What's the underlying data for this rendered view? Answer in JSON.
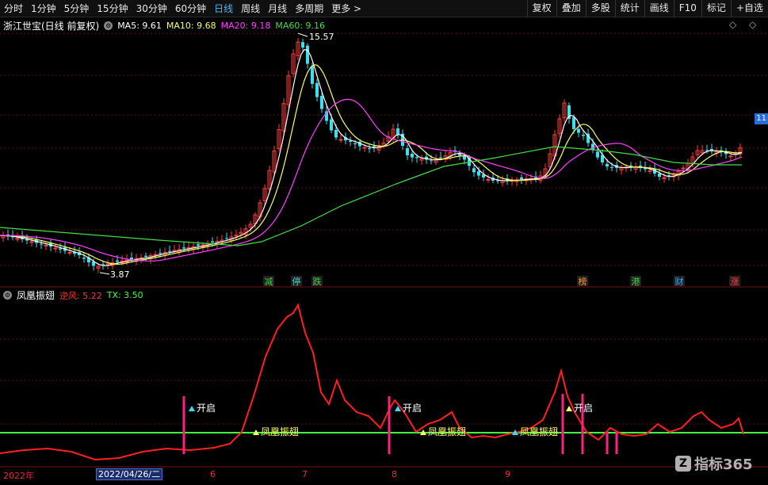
{
  "toolbar": {
    "periods": [
      "分时",
      "1分钟",
      "5分钟",
      "15分钟",
      "30分钟",
      "60分钟",
      "日线",
      "周线",
      "月线",
      "多周期",
      "更多 >"
    ],
    "active_period": "日线",
    "right_buttons": [
      "复权",
      "叠加",
      "多股",
      "统计",
      "画线",
      "F10",
      "标记",
      "+自选"
    ]
  },
  "main_info": {
    "stock_title": "浙江世宝(日线 前复权)",
    "ma5": "MA5: 9.61",
    "ma10": "MA10: 9.68",
    "ma20": "MA20: 9.18",
    "ma60": "MA60: 9.16"
  },
  "sub_info": {
    "indicator_name": "凤凰振翅",
    "nifeng": "逆风: 5.22",
    "tx": "TX: 3.50"
  },
  "price_tag": "11",
  "corner_icons": [
    "◇",
    "◇"
  ],
  "footer": {
    "year": "2022年",
    "cursor_date": "2022/04/26/二",
    "month_ticks": [
      "6",
      "7",
      "8",
      "9"
    ]
  },
  "watermark": "指标365",
  "colors": {
    "up": "#ff3b3b",
    "down": "#3ce0f0",
    "ma5": "#ffffff",
    "ma10": "#ffff60",
    "ma20": "#ff40ff",
    "ma60": "#40e040",
    "indicator_line": "#ff2020",
    "threshold_line": "#40ff40",
    "signal_bar": "#ff2080"
  },
  "chart_data": {
    "type": "candlestick",
    "price_annotations": {
      "high": "15.57",
      "low": "3.87"
    },
    "high_low": {
      "high": 15.57,
      "low": 3.87
    },
    "ma_series": [
      "MA5",
      "MA10",
      "MA20",
      "MA60"
    ],
    "event_markers": [
      "减",
      "停",
      "跌",
      "榜",
      "港",
      "财",
      "涨"
    ],
    "indicator": {
      "name": "凤凰振翅",
      "signal_labels": [
        "开启",
        "凤凰振翅",
        "开启",
        "凤凰振翅",
        "凤凰振翅",
        "开启"
      ]
    }
  }
}
